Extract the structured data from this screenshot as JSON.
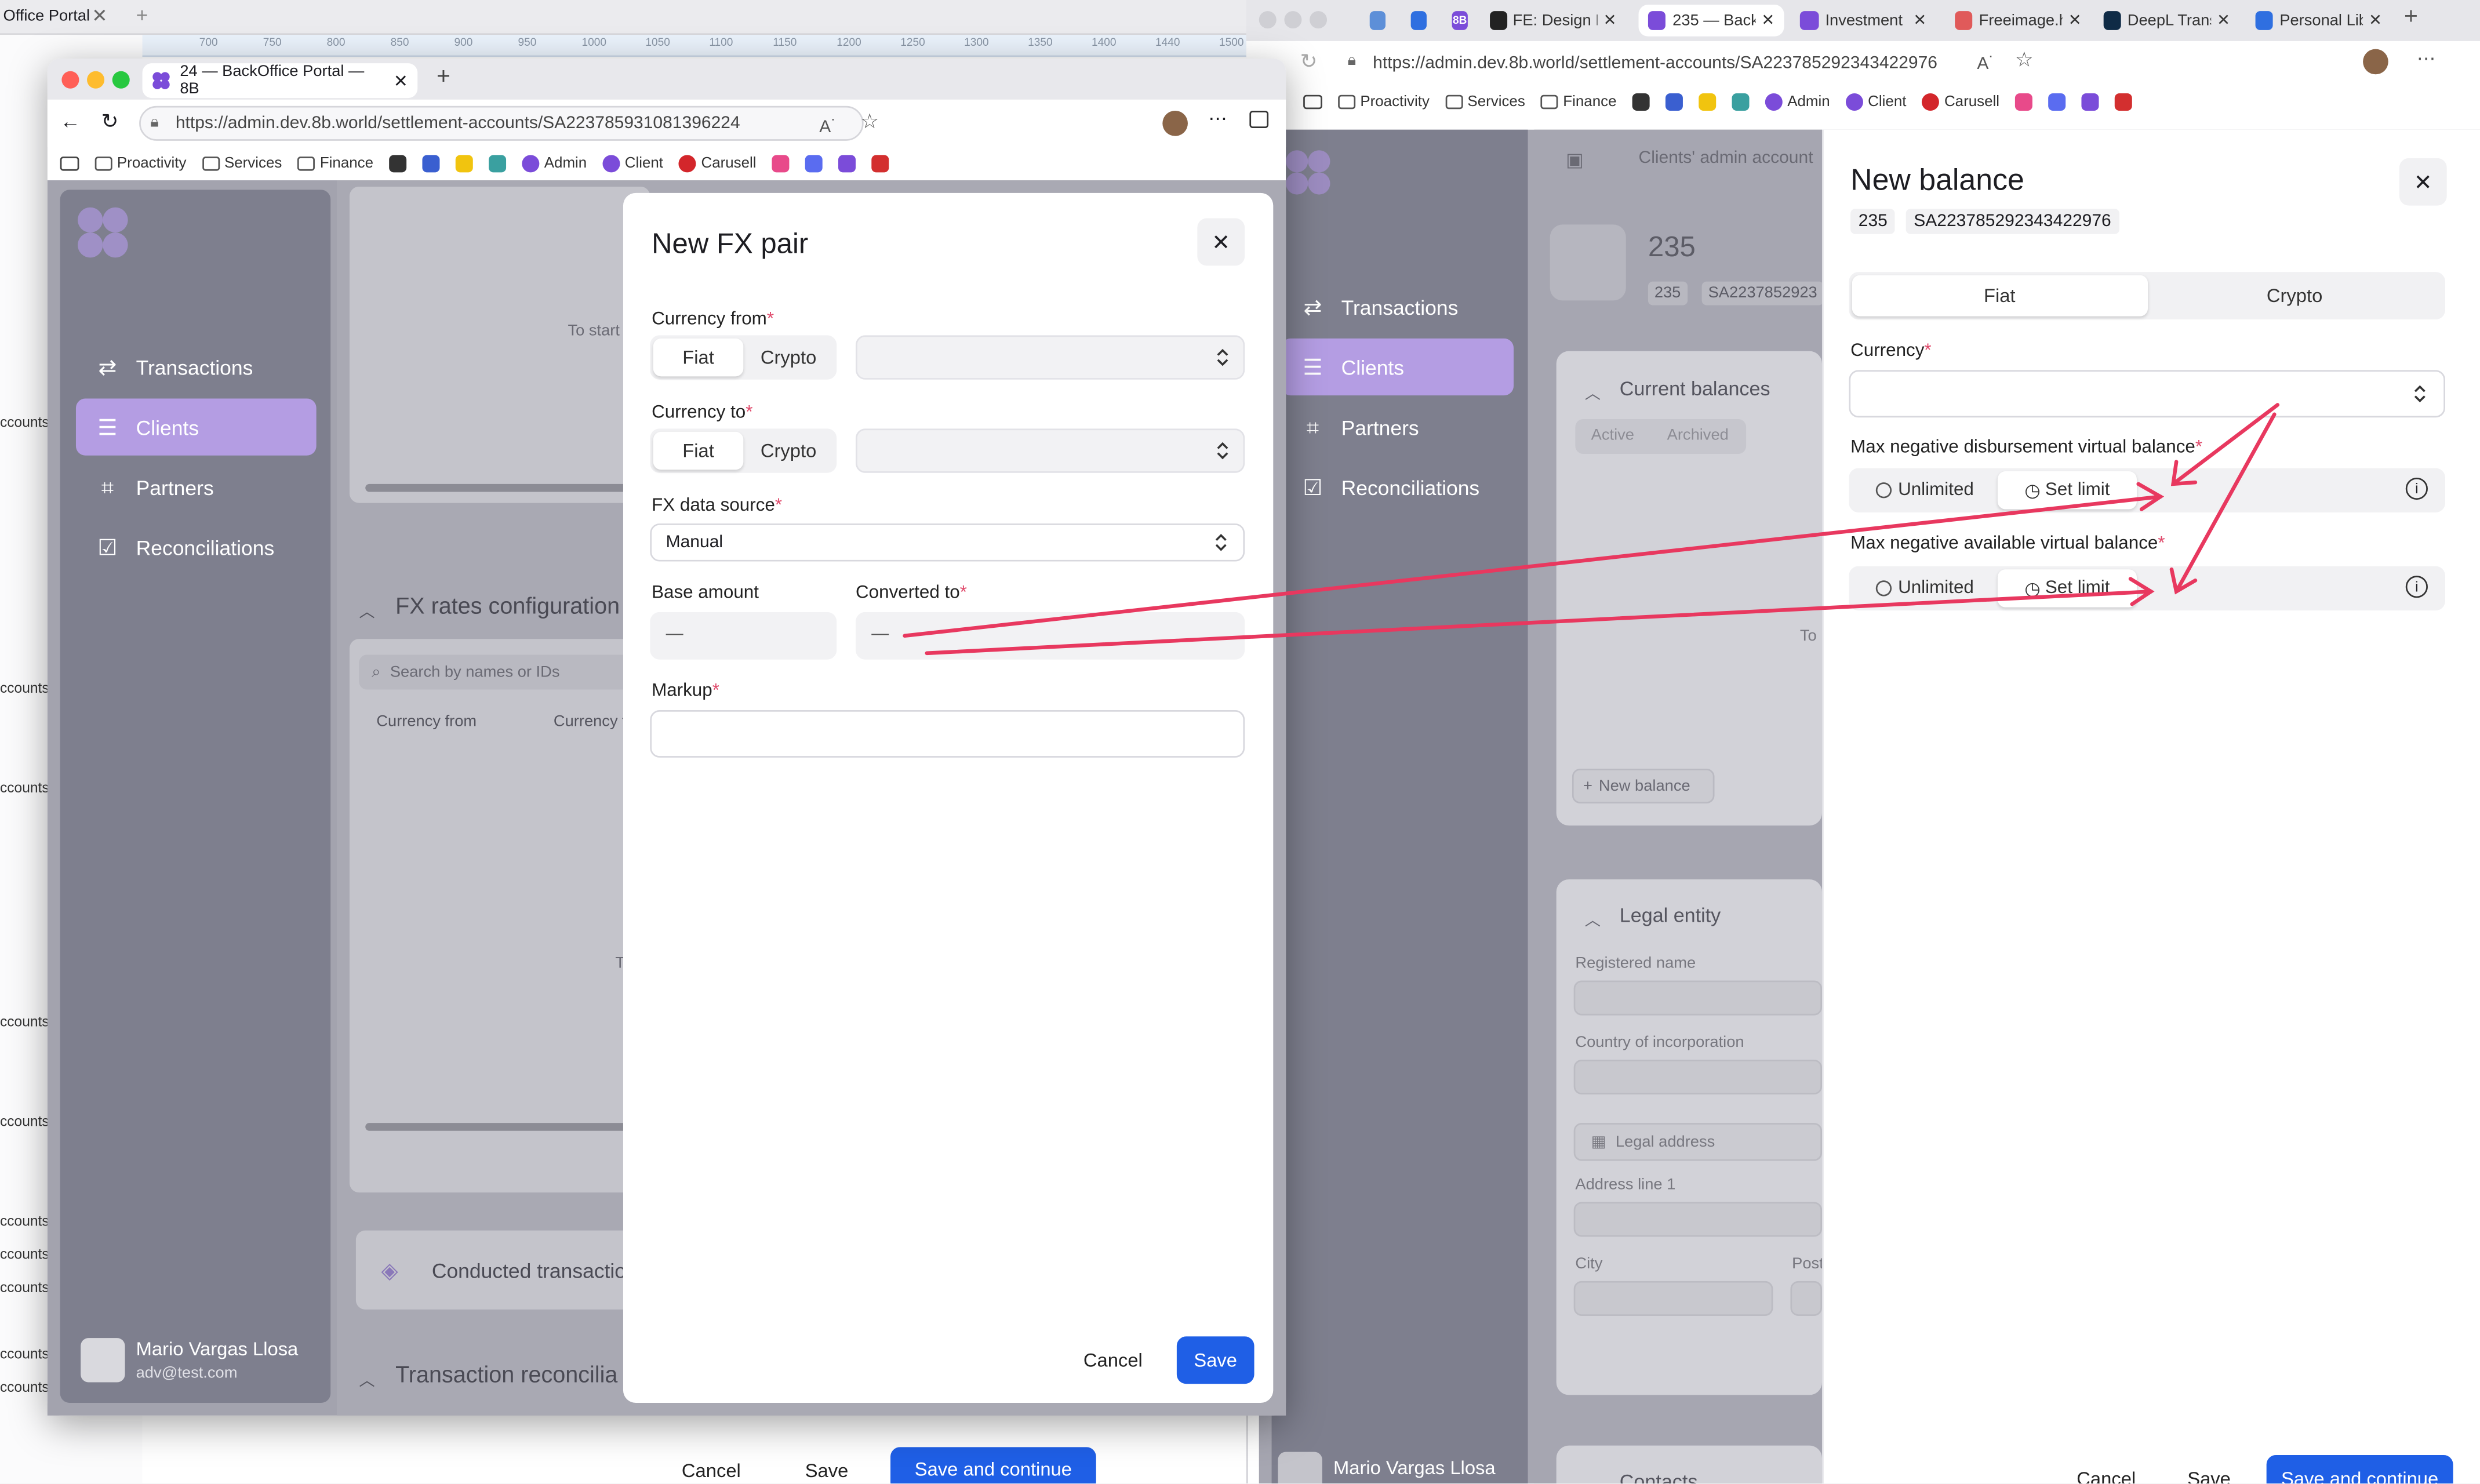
{
  "background": {
    "left_tab_title": "Office Portal",
    "ruler_ticks": [
      "700",
      "750",
      "800",
      "850",
      "900",
      "950",
      "1000",
      "1050",
      "1100",
      "1150",
      "1200",
      "1250",
      "1300",
      "1350",
      "1400",
      "1440",
      "1500"
    ],
    "left_links": [
      "ccounts",
      "ccounts",
      "ccounts",
      "ccounts",
      "ccounts",
      "ccounts",
      "ccounts",
      "ccounts",
      "ccounts",
      "ccounts",
      "ccounts",
      "ccounts"
    ]
  },
  "right_browser": {
    "tabs": [
      {
        "label": "",
        "icon": "vertex-icon",
        "color": "#5d8fd8"
      },
      {
        "label": "",
        "icon": "q-icon",
        "color": "#2f6fe0"
      },
      {
        "label": "8B",
        "icon": "8b-icon",
        "color": "#7b4cd9"
      },
      {
        "label": "FE: Design Fl",
        "icon": "notion-icon",
        "color": "#222"
      },
      {
        "label": "235 — Back",
        "icon": "eightb-icon",
        "color": "#7b4cd9"
      },
      {
        "label": "Investment",
        "icon": "eightb-icon",
        "color": "#7b4cd9"
      },
      {
        "label": "Freeimage.h",
        "icon": "freeimage-icon",
        "color": "#e05a5a"
      },
      {
        "label": "DeepL Trans",
        "icon": "deepl-icon",
        "color": "#0f2b46"
      },
      {
        "label": "Personal Lib",
        "icon": "personal-icon",
        "color": "#2f6fe0"
      }
    ],
    "url": "https://admin.dev.8b.world/settlement-accounts/SA223785292343422976",
    "bookmarks": [
      "Proactivity",
      "Services",
      "Finance",
      "Admin",
      "Client",
      "Carusell"
    ],
    "app": {
      "breadcrumb": "Clients' admin account",
      "account_name": "235",
      "account_tag1": "235",
      "account_tag2": "SA2237852923",
      "nav": [
        "Transactions",
        "Clients",
        "Partners",
        "Reconciliations"
      ],
      "current_balances": "Current balances",
      "tab_active": "Active",
      "tab_archived": "Archived",
      "to_text": "To",
      "new_balance_button": "New balance",
      "legal_entity": "Legal entity",
      "registered_name": "Registered name",
      "country": "Country of incorporation",
      "legal_address": "Legal address",
      "address_line1": "Address line 1",
      "city": "City",
      "post": "Post",
      "user": "Mario Vargas Llosa",
      "contacts": "Contacts"
    },
    "drawer": {
      "title": "New balance",
      "tag1": "235",
      "tag2": "SA223785292343422976",
      "seg_fiat": "Fiat",
      "seg_crypto": "Crypto",
      "currency_label": "Currency",
      "max_disb_label": "Max negative disbursement virtual balance",
      "max_avail_label": "Max negative available virtual balance",
      "unlimited": "Unlimited",
      "set_limit": "Set limit",
      "cancel": "Cancel",
      "save": "Save",
      "save_continue": "Save and continue"
    }
  },
  "left_window": {
    "tab_title": "24 — BackOffice Portal — 8B",
    "url": "https://admin.dev.8b.world/settlement-accounts/SA223785931081396224",
    "bookmarks": [
      "Proactivity",
      "Services",
      "Finance",
      "Admin",
      "Client",
      "Carusell"
    ],
    "nav": [
      "Transactions",
      "Clients",
      "Partners",
      "Reconciliations"
    ],
    "user_name": "Mario Vargas Llosa",
    "user_email": "adv@test.com",
    "bg": {
      "to_start": "To start",
      "fx_rates": "FX rates configuration",
      "search_placeholder": "Search by names or IDs",
      "col1": "Currency from",
      "col2": "Currency t",
      "to_short": "To",
      "conducted": "Conducted transactio",
      "tx_recon": "Transaction reconcilia",
      "cancel": "Cancel",
      "save": "Save",
      "save_continue": "Save and continue"
    },
    "modal": {
      "title": "New FX pair",
      "currency_from": "Currency from",
      "currency_to": "Currency to",
      "fiat": "Fiat",
      "crypto": "Crypto",
      "fx_source": "FX data source",
      "fx_source_value": "Manual",
      "base_amount": "Base amount",
      "base_value": "—",
      "converted_to": "Converted to",
      "converted_value": "—",
      "markup": "Markup",
      "cancel": "Cancel",
      "save": "Save"
    }
  },
  "colors": {
    "accent": "#1f5fe6",
    "nav_selected": "#b49de3",
    "annotation": "#e8385f",
    "brand": "#7b4cd9"
  }
}
